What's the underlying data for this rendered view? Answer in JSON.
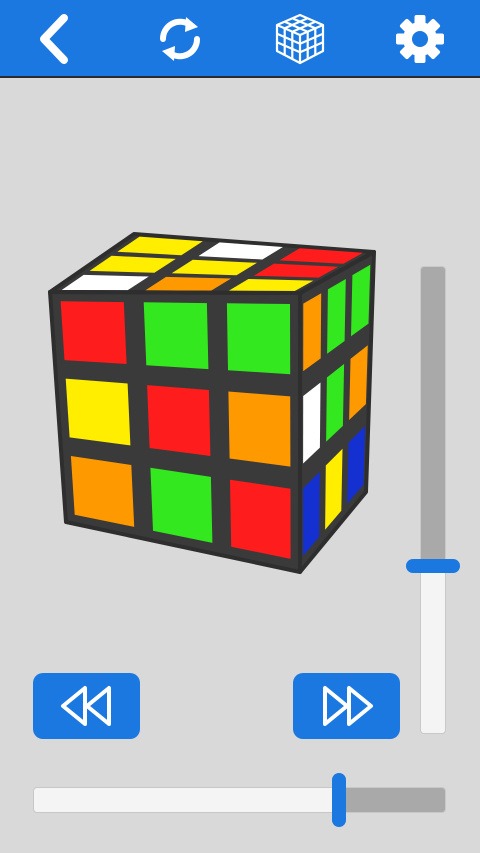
{
  "toolbar": {
    "icons": [
      "back-arrow-icon",
      "rotate-refresh-icon",
      "cube-grid-icon",
      "gear-icon"
    ],
    "icon_color": "#ffffff",
    "background": "#1a78e0"
  },
  "colors": {
    "W": "#ffffff",
    "Y": "#ffee00",
    "R": "#ff1c1c",
    "G": "#33e81e",
    "O": "#ff9900",
    "B": "#1530d0",
    "accent": "#1a78e0",
    "background": "#d9d9d9"
  },
  "cube": {
    "top": [
      [
        "Y",
        "W",
        "R"
      ],
      [
        "Y",
        "Y",
        "R"
      ],
      [
        "W",
        "O",
        "Y"
      ]
    ],
    "front": [
      [
        "R",
        "G",
        "G"
      ],
      [
        "Y",
        "R",
        "O"
      ],
      [
        "O",
        "G",
        "R"
      ]
    ],
    "right": [
      [
        "O",
        "G",
        "G"
      ],
      [
        "W",
        "G",
        "O"
      ],
      [
        "B",
        "Y",
        "B"
      ]
    ]
  },
  "controls": {
    "rewind_icon": "rewind-icon",
    "fast_forward_icon": "fast-forward-icon",
    "vertical_slider_value": 0.64,
    "horizontal_slider_value": 0.74
  }
}
